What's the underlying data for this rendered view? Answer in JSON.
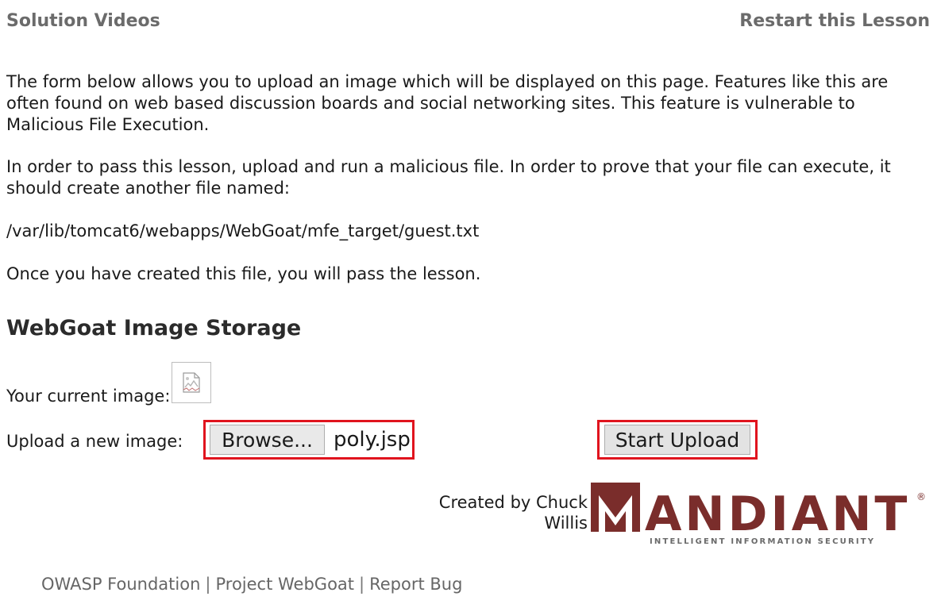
{
  "header": {
    "solution_videos": "Solution Videos",
    "restart_lesson": "Restart this Lesson"
  },
  "intro": {
    "p1": "The form below allows you to upload an image which will be displayed on this page. Features like this are often found on web based discussion boards and social networking sites. This feature is vulnerable to Malicious File Execution.",
    "p2": "In order to pass this lesson, upload and run a malicious file. In order to prove that your file can execute, it should create another file named:",
    "p3": "/var/lib/tomcat6/webapps/WebGoat/mfe_target/guest.txt",
    "p4": "Once you have created this file, you will pass the lesson."
  },
  "storage": {
    "title": "WebGoat Image Storage",
    "current_image_label": "Your current image:",
    "current_image_icon": "broken-image-icon",
    "upload_label": "Upload a new image:",
    "browse_label": "Browse...",
    "file_name": "poly.jsp",
    "start_upload_label": "Start Upload",
    "highlight_color": "#e0141e"
  },
  "credits": {
    "created_by": "Created by Chuck Willis",
    "logo_text": "ANDIANT",
    "logo_registered": "®",
    "logo_tagline": "INTELLIGENT INFORMATION SECURITY",
    "logo_color": "#7a2d2b"
  },
  "footer": {
    "links": [
      "OWASP Foundation",
      "Project WebGoat",
      "Report Bug"
    ],
    "separator": "|"
  }
}
